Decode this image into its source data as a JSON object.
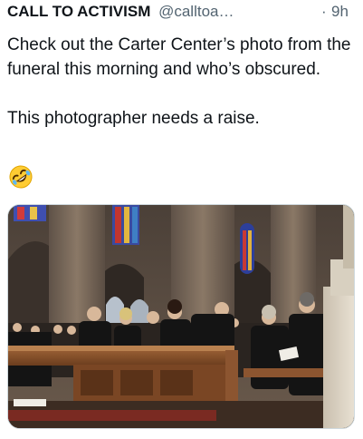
{
  "tweet": {
    "author_name": "CALL TO ACTIVISM",
    "handle": "@calltoa…",
    "separator": "·",
    "time": "9h",
    "text_paragraph_1": "Check out the Carter Center’s photo from the funeral this morning and who’s obscured.",
    "text_paragraph_2": "This photographer needs a raise.",
    "emoji": "rolling-on-floor-laughing-emoji"
  },
  "media": {
    "type": "photo",
    "icon": "photo"
  },
  "colors": {
    "text_primary": "#0f1419",
    "text_secondary": "#536471",
    "card_border": "#cfd9de"
  }
}
